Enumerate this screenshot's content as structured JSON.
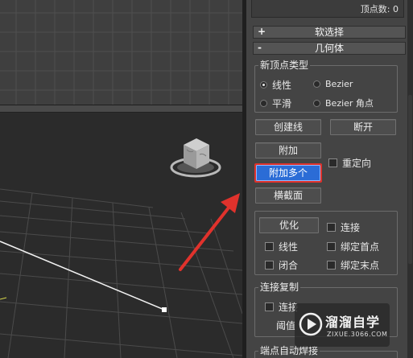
{
  "panel": {
    "vertex_count": "顶点数: 0",
    "rollouts": [
      {
        "sign": "+",
        "title": "软选择"
      },
      {
        "sign": "-",
        "title": "几何体"
      }
    ],
    "new_vertex_type": {
      "title": "新顶点类型",
      "options": [
        {
          "label": "线性",
          "checked": true
        },
        {
          "label": "Bezier",
          "checked": false
        },
        {
          "label": "平滑",
          "checked": false
        },
        {
          "label": "Bezier 角点",
          "checked": false
        }
      ]
    },
    "buttons": {
      "create_line": "创建线",
      "break": "断开",
      "attach": "附加",
      "attach_multiple": "附加多个",
      "cross_section": "横截面",
      "refine": "优化"
    },
    "checks": {
      "reorient": "重定向",
      "connect": "连接",
      "linear": "线性",
      "bind_first": "绑定首点",
      "closed": "闭合",
      "bind_last": "绑定末点",
      "connect2": "连接"
    },
    "connect_copy": {
      "title": "连接复制",
      "threshold_label": "阈值"
    },
    "endpoint_auto_weld": {
      "title": "端点自动焊接"
    }
  },
  "watermark": {
    "name": "溜溜自学",
    "url": "ZIXUE.3066.COM"
  },
  "colors": {
    "active_button": "#2b6cd6",
    "highlight_box": "#e0322c",
    "arrow": "#e0322c"
  }
}
